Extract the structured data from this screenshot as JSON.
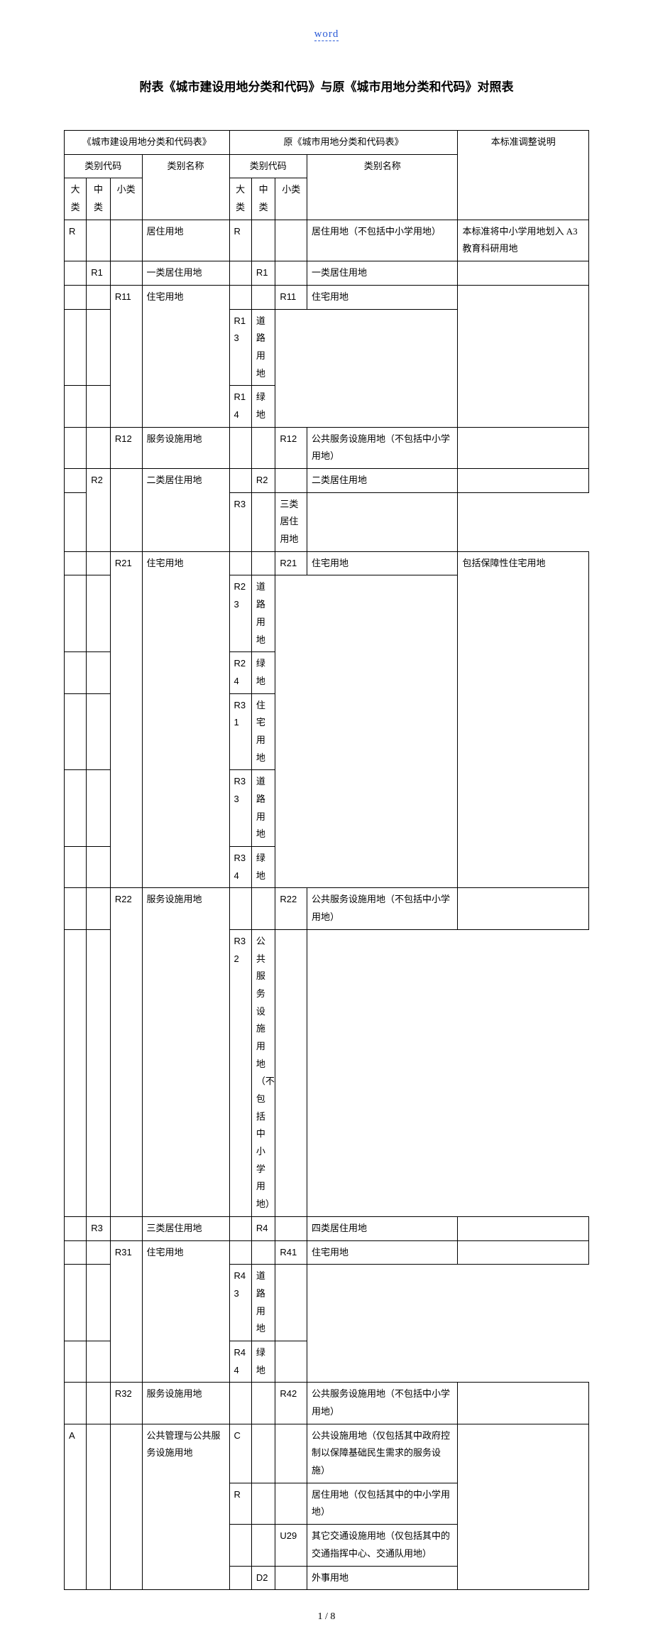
{
  "header_label": "word",
  "title": "附表《城市建设用地分类和代码》与原《城市用地分类和代码》对照表",
  "footer": "1 / 8",
  "thead": {
    "left_group": "《城市建设用地分类和代码表》",
    "right_group": "原《城市用地分类和代码表》",
    "notes_label": "本标准调整说明",
    "code_label": "类别代码",
    "name_label": "类别名称",
    "big": "大类",
    "mid": "中类",
    "small": "小类"
  },
  "rows": [
    {
      "l_big": "R",
      "l_mid": "",
      "l_small": "",
      "l_name": "居住用地",
      "r_big": "R",
      "r_mid": "",
      "r_small": "",
      "r_name": "居住用地（不包括中小学用地）",
      "note": "本标准将中小学用地划入 A3 教育科研用地"
    },
    {
      "l_big": "",
      "l_mid": "R1",
      "l_small": "",
      "l_name": "一类居住用地",
      "r_big": "",
      "r_mid": "R1",
      "r_small": "",
      "r_name": "一类居住用地",
      "note": ""
    },
    {
      "l_big": "",
      "l_mid": "",
      "l_small": "R11",
      "l_name": "住宅用地",
      "r_big": "",
      "r_mid": "",
      "r_small": "R11",
      "r_name": "住宅用地",
      "note": "",
      "l_small_rowspan": 3,
      "l_name_rowspan": 3,
      "note_rowspan": 3
    },
    {
      "r_big": "",
      "r_mid": "",
      "r_small": "R13",
      "r_name": "道路用地"
    },
    {
      "r_big": "",
      "r_mid": "",
      "r_small": "R14",
      "r_name": "绿地"
    },
    {
      "l_big": "",
      "l_mid": "",
      "l_small": "R12",
      "l_name": "服务设施用地",
      "r_big": "",
      "r_mid": "",
      "r_small": "R12",
      "r_name": "公共服务设施用地（不包括中小学用地）",
      "note": ""
    },
    {
      "l_big": "",
      "l_mid": "R2",
      "l_small": "",
      "l_name": "二类居住用地",
      "r_big": "",
      "r_mid": "R2",
      "r_small": "",
      "r_name": "二类居住用地",
      "note": "",
      "l_mid_rowspan": 2,
      "l_small_rowspan": 2,
      "l_name_rowspan": 2
    },
    {
      "r_big": "",
      "r_mid": "R3",
      "r_small": "",
      "r_name": "三类居住用地",
      "note": ""
    },
    {
      "l_big": "",
      "l_mid": "",
      "l_small": "R21",
      "l_name": "住宅用地",
      "r_big": "",
      "r_mid": "",
      "r_small": "R21",
      "r_name": "住宅用地",
      "note": "包括保障性住宅用地",
      "l_small_rowspan": 6,
      "l_name_rowspan": 6,
      "note_rowspan": 6
    },
    {
      "r_big": "",
      "r_mid": "",
      "r_small": "R23",
      "r_name": "道路用地"
    },
    {
      "r_big": "",
      "r_mid": "",
      "r_small": "R24",
      "r_name": "绿地"
    },
    {
      "r_big": "",
      "r_mid": "",
      "r_small": "R31",
      "r_name": "住宅用地"
    },
    {
      "r_big": "",
      "r_mid": "",
      "r_small": "R33",
      "r_name": "道路用地"
    },
    {
      "r_big": "",
      "r_mid": "",
      "r_small": "R34",
      "r_name": "绿地"
    },
    {
      "l_big": "",
      "l_mid": "",
      "l_small": "R22",
      "l_name": "服务设施用地",
      "r_big": "",
      "r_mid": "",
      "r_small": "R22",
      "r_name": "公共服务设施用地（不包括中小学用地）",
      "note": "",
      "l_small_rowspan": 2,
      "l_name_rowspan": 2
    },
    {
      "r_big": "",
      "r_mid": "",
      "r_small": "R32",
      "r_name": "公共服务设施用地（不包括中小学用地）",
      "note": ""
    },
    {
      "l_big": "",
      "l_mid": "R3",
      "l_small": "",
      "l_name": "三类居住用地",
      "r_big": "",
      "r_mid": "R4",
      "r_small": "",
      "r_name": "四类居住用地",
      "note": ""
    },
    {
      "l_big": "",
      "l_mid": "",
      "l_small": "R31",
      "l_name": "住宅用地",
      "r_big": "",
      "r_mid": "",
      "r_small": "R41",
      "r_name": "住宅用地",
      "note": "",
      "l_small_rowspan": 3,
      "l_name_rowspan": 3
    },
    {
      "r_big": "",
      "r_mid": "",
      "r_small": "R43",
      "r_name": "道路用地",
      "note": ""
    },
    {
      "r_big": "",
      "r_mid": "",
      "r_small": "R44",
      "r_name": "绿地",
      "note": ""
    },
    {
      "l_big": "",
      "l_mid": "",
      "l_small": "R32",
      "l_name": "服务设施用地",
      "r_big": "",
      "r_mid": "",
      "r_small": "R42",
      "r_name": "公共服务设施用地（不包括中小学用地）",
      "note": ""
    },
    {
      "l_big": "A",
      "l_mid": "",
      "l_small": "",
      "l_name": "公共管理与公共服务设施用地",
      "r_big": "C",
      "r_mid": "",
      "r_small": "",
      "r_name": "公共设施用地（仅包括其中政府控制以保障基础民生需求的服务设施）",
      "note": "",
      "l_big_rowspan": 4,
      "l_mid_rowspan": 4,
      "l_small_rowspan": 4,
      "l_name_rowspan": 4,
      "note_rowspan": 4
    },
    {
      "r_big": "R",
      "r_mid": "",
      "r_small": "",
      "r_name": "居住用地（仅包括其中的中小学用地）"
    },
    {
      "r_big": "",
      "r_mid": "",
      "r_small": "U29",
      "r_name": "其它交通设施用地（仅包括其中的交通指挥中心、交通队用地）"
    },
    {
      "r_big": "",
      "r_mid": "D2",
      "r_small": "",
      "r_name": "外事用地"
    }
  ]
}
